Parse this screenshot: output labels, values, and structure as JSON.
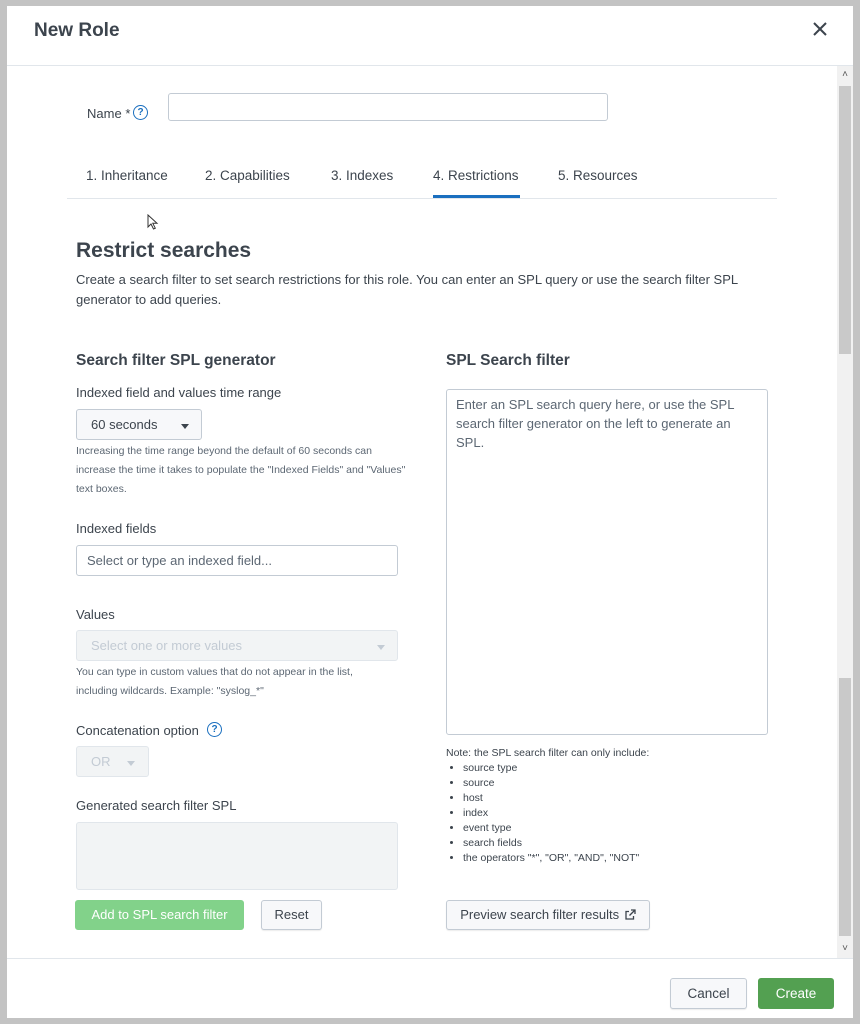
{
  "dialog": {
    "title": "New Role"
  },
  "name_field": {
    "label": "Name",
    "required_mark": "*",
    "value": "",
    "placeholder": ""
  },
  "tabs": [
    {
      "label": "1. Inheritance",
      "active": false
    },
    {
      "label": "2. Capabilities",
      "active": false
    },
    {
      "label": "3. Indexes",
      "active": false
    },
    {
      "label": "4. Restrictions",
      "active": true
    },
    {
      "label": "5. Resources",
      "active": false
    }
  ],
  "section": {
    "title": "Restrict searches",
    "description": "Create a search filter to set search restrictions for this role. You can enter an SPL query or use the search filter SPL generator to add queries."
  },
  "generator": {
    "heading": "Search filter SPL generator",
    "time_range_label": "Indexed field and values time range",
    "time_range_value": "60 seconds",
    "time_range_help": "Increasing the time range beyond the default of 60 seconds can increase the time it takes to populate the \"Indexed Fields\" and \"Values\" text boxes.",
    "indexed_fields_label": "Indexed fields",
    "indexed_fields_placeholder": "Select or type an indexed field...",
    "values_label": "Values",
    "values_placeholder": "Select one or more values",
    "values_help": "You can type in custom values that do not appear in the list, including wildcards. Example: \"syslog_*\"",
    "concat_label": "Concatenation option",
    "concat_value": "OR",
    "generated_label": "Generated search filter SPL",
    "add_button": "Add to SPL search filter",
    "reset_button": "Reset"
  },
  "spl_filter": {
    "heading": "SPL Search filter",
    "placeholder": "Enter an SPL search query here, or use the SPL search filter generator on the left to generate an SPL.",
    "note_title": "Note: the SPL search filter can only include:",
    "note_items": [
      "source type",
      "source",
      "host",
      "index",
      "event type",
      "search fields",
      "the operators \"*\", \"OR\", \"AND\", \"NOT\""
    ],
    "preview_button": "Preview search filter results"
  },
  "footer": {
    "cancel": "Cancel",
    "create": "Create"
  },
  "colors": {
    "primary_green": "#53a051",
    "disabled_green": "#82d28a",
    "tab_active": "#1a6fbf",
    "text": "#3c444d"
  }
}
